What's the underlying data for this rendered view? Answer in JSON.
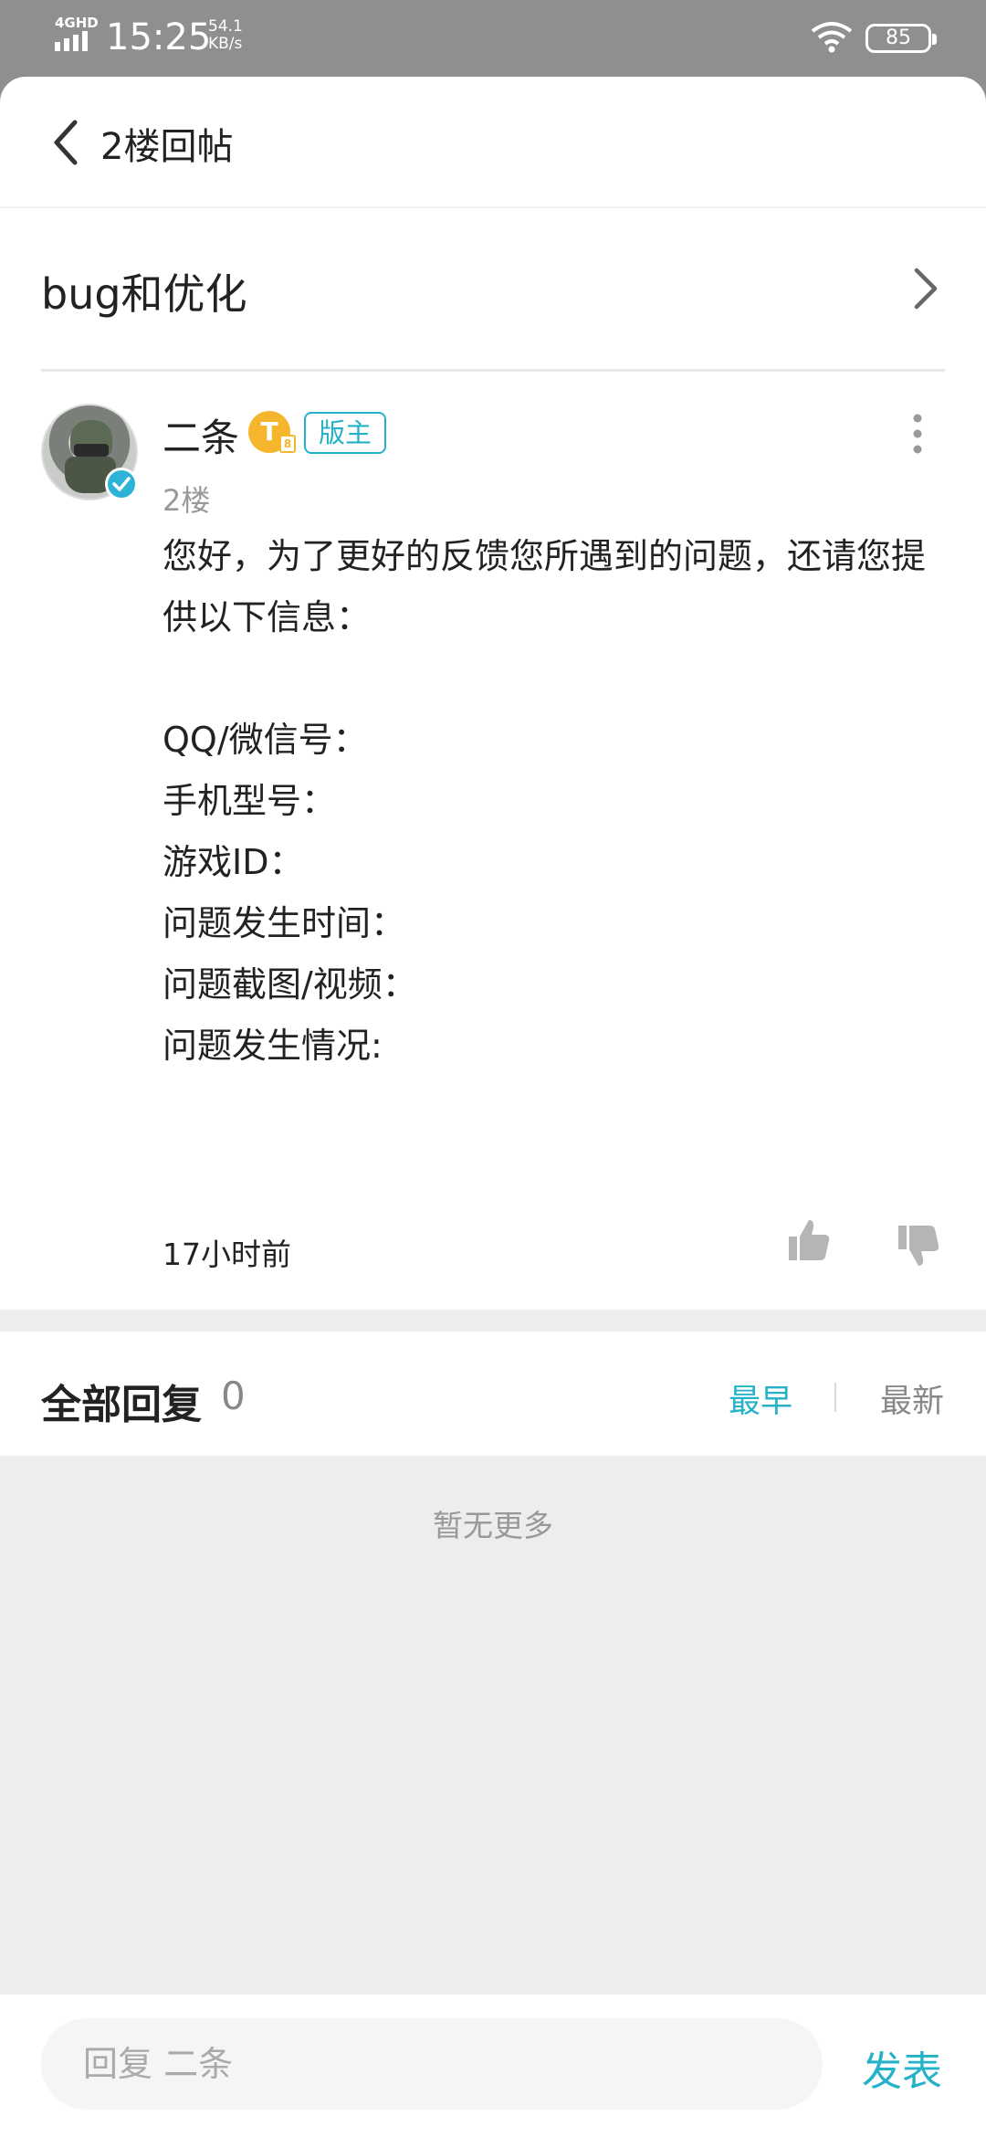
{
  "status_bar": {
    "network": "4GHD",
    "time": "15:25",
    "speed_value": "54.1",
    "speed_unit": "KB/s",
    "battery": "85"
  },
  "header": {
    "title": "2楼回帖"
  },
  "thread": {
    "title": "bug和优化"
  },
  "post": {
    "username": "二条",
    "level_badge": "T",
    "level_sub": "8",
    "role": "版主",
    "floor": "2楼",
    "content": "您好，为了更好的反馈您所遇到的问题，还请您提供以下信息：\n\nQQ/微信号：\n手机型号：\n游戏ID：\n问题发生时间：\n问题截图/视频：\n问题发生情况:",
    "time": "17小时前"
  },
  "replies": {
    "title": "全部回复",
    "count": "0",
    "sort_earliest": "最早",
    "sort_latest": "最新",
    "empty_text": "暂无更多"
  },
  "bottom": {
    "placeholder": "回复 二条",
    "publish": "发表"
  },
  "colors": {
    "accent": "#23b2c8",
    "badge_gold": "#f5b52c"
  }
}
